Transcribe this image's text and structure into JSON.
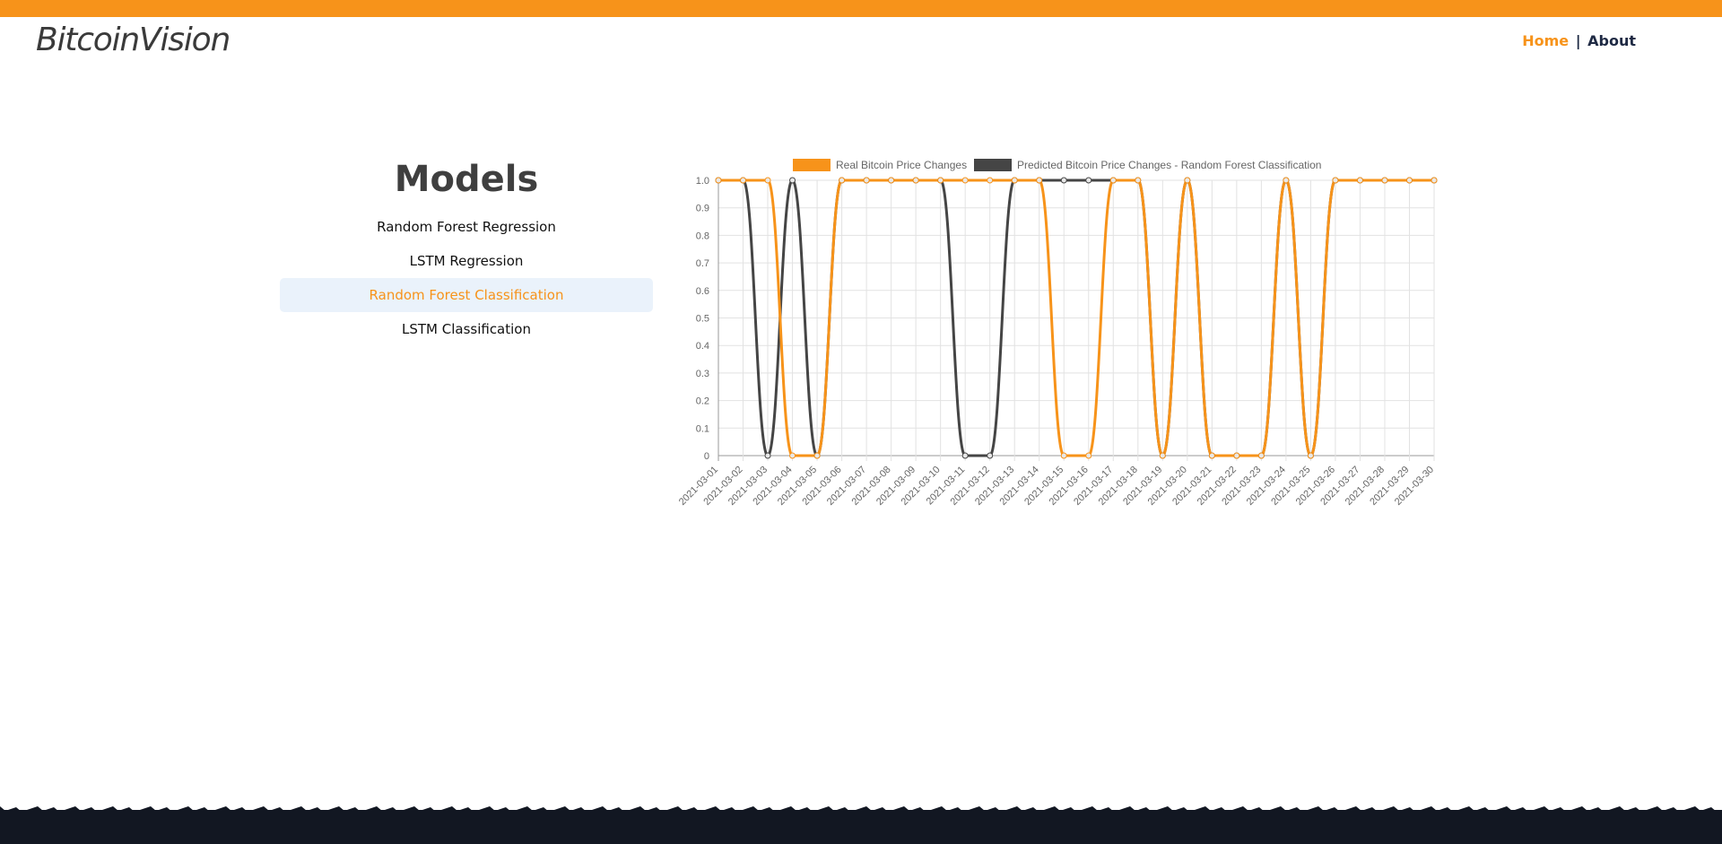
{
  "header": {
    "brand": "BitcoinVision",
    "nav_home": "Home",
    "nav_separator": "|",
    "nav_about": "About"
  },
  "models": {
    "title": "Models",
    "items": [
      {
        "label": "Random Forest Regression",
        "active": false
      },
      {
        "label": "LSTM Regression",
        "active": false
      },
      {
        "label": "Random Forest Classification",
        "active": true
      },
      {
        "label": "LSTM Classification",
        "active": false
      }
    ]
  },
  "colors": {
    "accent": "#f7931a",
    "predicted": "#454545",
    "active_bg": "#eaf2fb",
    "footer": "#121722"
  },
  "chart_data": {
    "type": "line",
    "x": [
      "2021-03-01",
      "2021-03-02",
      "2021-03-03",
      "2021-03-04",
      "2021-03-05",
      "2021-03-06",
      "2021-03-07",
      "2021-03-08",
      "2021-03-09",
      "2021-03-10",
      "2021-03-11",
      "2021-03-12",
      "2021-03-13",
      "2021-03-14",
      "2021-03-15",
      "2021-03-16",
      "2021-03-17",
      "2021-03-18",
      "2021-03-19",
      "2021-03-20",
      "2021-03-21",
      "2021-03-22",
      "2021-03-23",
      "2021-03-24",
      "2021-03-25",
      "2021-03-26",
      "2021-03-27",
      "2021-03-28",
      "2021-03-29",
      "2021-03-30"
    ],
    "series": [
      {
        "name": "Real Bitcoin Price Changes",
        "color": "#f7931a",
        "values": [
          1,
          1,
          1,
          0,
          0,
          1,
          1,
          1,
          1,
          1,
          1,
          1,
          1,
          1,
          0,
          0,
          1,
          1,
          0,
          1,
          0,
          0,
          0,
          1,
          0,
          1,
          1,
          1,
          1,
          1
        ]
      },
      {
        "name": "Predicted Bitcoin Price Changes - Random Forest Classification",
        "color": "#454545",
        "values": [
          1,
          1,
          0,
          1,
          0,
          1,
          1,
          1,
          1,
          1,
          0,
          0,
          1,
          1,
          1,
          1,
          1,
          1,
          0,
          1,
          0,
          0,
          0,
          1,
          0,
          1,
          1,
          1,
          1,
          1
        ]
      }
    ],
    "ylim": [
      0,
      1
    ],
    "yticks": [
      "0",
      "0.1",
      "0.2",
      "0.3",
      "0.4",
      "0.5",
      "0.6",
      "0.7",
      "0.8",
      "0.9",
      "1.0"
    ],
    "grid": true,
    "legend_position": "top"
  }
}
